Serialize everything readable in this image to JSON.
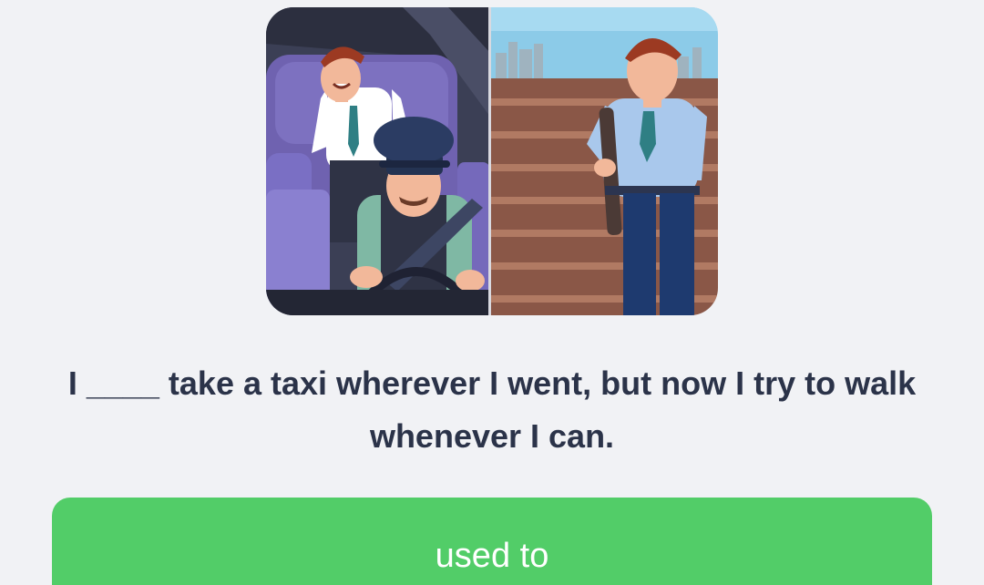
{
  "illustration": {
    "icon": "taxi-vs-walking-illustration"
  },
  "question": {
    "text": "I ____ take a taxi wherever I went, but now I try to walk whenever I can."
  },
  "answers": [
    {
      "label": "used to"
    }
  ],
  "colors": {
    "background": "#f1f2f5",
    "text": "#2b3349",
    "answer_button": "#52cd68",
    "answer_text": "#ffffff"
  }
}
